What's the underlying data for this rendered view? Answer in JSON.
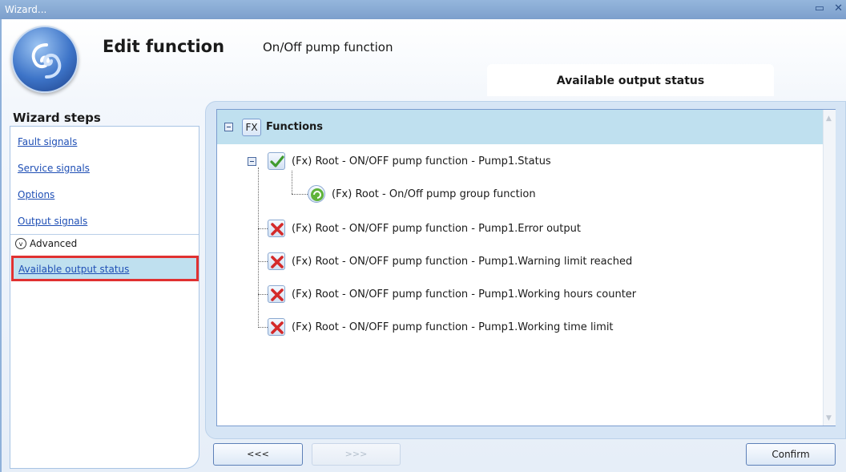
{
  "window": {
    "title": "Wizard..."
  },
  "header": {
    "edit_title": "Edit function",
    "function_name": "On/Off pump function",
    "section_title": "Available output status"
  },
  "sidebar": {
    "title": "Wizard steps",
    "steps": [
      {
        "label": "Fault signals"
      },
      {
        "label": "Service signals"
      },
      {
        "label": "Options"
      },
      {
        "label": "Output signals"
      }
    ],
    "advanced_label": "Advanced",
    "active_step": "Available output status"
  },
  "tree": {
    "root_icon_text": "FX",
    "root_label": "Functions",
    "items": [
      {
        "label": "(Fx) Root - ON/OFF pump function - Pump1.Status",
        "icon": "check-icon"
      },
      {
        "label": "(Fx) Root - On/Off pump group function",
        "icon": "pump-group-icon"
      },
      {
        "label": "(Fx) Root - ON/OFF pump function - Pump1.Error output",
        "icon": "cross-icon"
      },
      {
        "label": "(Fx) Root - ON/OFF pump function - Pump1.Warning limit reached",
        "icon": "cross-icon"
      },
      {
        "label": "(Fx) Root - ON/OFF pump function - Pump1.Working hours counter",
        "icon": "cross-icon"
      },
      {
        "label": "(Fx) Root - ON/OFF pump function - Pump1.Working time limit",
        "icon": "cross-icon"
      }
    ]
  },
  "buttons": {
    "back": "<<<",
    "next": ">>>",
    "confirm": "Confirm"
  },
  "colors": {
    "highlight": "#e03131",
    "selection": "#bfe0ef",
    "link": "#1f4fb5"
  }
}
